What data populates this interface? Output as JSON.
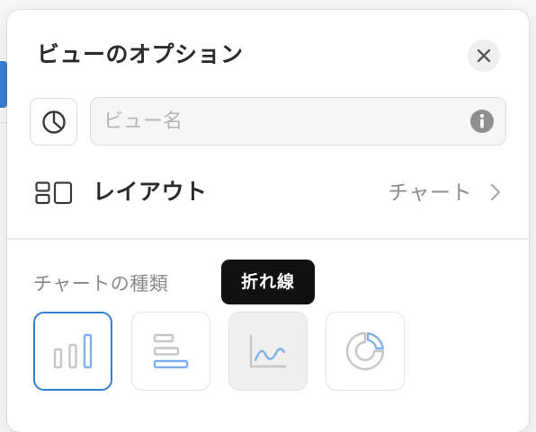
{
  "panel": {
    "title": "ビューのオプション"
  },
  "view_name": {
    "placeholder": "ビュー名",
    "value": ""
  },
  "layout": {
    "label": "レイアウト",
    "value": "チャート"
  },
  "chart_type": {
    "section_label": "チャートの種類",
    "tooltip": "折れ線",
    "options": [
      {
        "id": "vertical-bar",
        "icon": "vertical-bar-chart-icon",
        "selected": true
      },
      {
        "id": "horizontal-bar",
        "icon": "horizontal-bar-chart-icon",
        "selected": false
      },
      {
        "id": "line",
        "icon": "line-chart-icon",
        "selected": false,
        "hovered": true
      },
      {
        "id": "donut",
        "icon": "donut-chart-icon",
        "selected": false
      }
    ]
  },
  "colors": {
    "accent": "#2f7ed8",
    "icon_blue": "#7fb0ec",
    "icon_gray": "#c6c6c4"
  }
}
